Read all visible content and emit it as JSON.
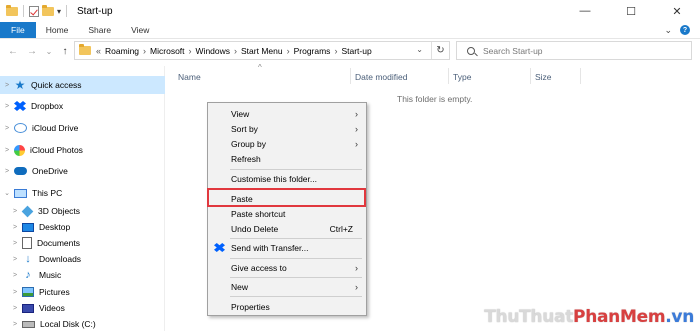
{
  "window": {
    "title": "Start-up",
    "minimize": "—",
    "maximize": "☐",
    "close": "✕"
  },
  "ribbon": {
    "tabs": [
      "File",
      "Home",
      "Share",
      "View"
    ],
    "expand_glyph": "⌄",
    "help_glyph": "?"
  },
  "nav": {
    "back": "←",
    "forward": "→",
    "recent": "⌄",
    "up": "↑",
    "breadcrumb_lead": "«",
    "breadcrumb": [
      "Roaming",
      "Microsoft",
      "Windows",
      "Start Menu",
      "Programs",
      "Start-up"
    ],
    "crumb_sep": "›",
    "refresh": "↻",
    "dropdown": "⌄",
    "search_placeholder": "Search Start-up"
  },
  "sidebar": {
    "items": [
      {
        "label": "Quick access",
        "icon": "star-icon"
      },
      {
        "label": "Dropbox",
        "icon": "dropbox-icon"
      },
      {
        "label": "iCloud Drive",
        "icon": "cloud-icon"
      },
      {
        "label": "iCloud Photos",
        "icon": "photos-icon"
      },
      {
        "label": "OneDrive",
        "icon": "onedrive-icon"
      },
      {
        "label": "This PC",
        "icon": "pc-icon"
      },
      {
        "label": "3D Objects",
        "icon": "cube-icon"
      },
      {
        "label": "Desktop",
        "icon": "desktop-icon"
      },
      {
        "label": "Documents",
        "icon": "document-icon"
      },
      {
        "label": "Downloads",
        "icon": "download-icon"
      },
      {
        "label": "Music",
        "icon": "music-icon"
      },
      {
        "label": "Pictures",
        "icon": "pictures-icon"
      },
      {
        "label": "Videos",
        "icon": "videos-icon"
      },
      {
        "label": "Local Disk (C:)",
        "icon": "disk-icon"
      }
    ]
  },
  "columns": {
    "name": "Name",
    "date_modified": "Date modified",
    "type": "Type",
    "size": "Size",
    "sort_glyph": "^"
  },
  "content": {
    "empty_message": "This folder is empty."
  },
  "context_menu": {
    "items": [
      {
        "label": "View",
        "submenu": true
      },
      {
        "label": "Sort by",
        "submenu": true
      },
      {
        "label": "Group by",
        "submenu": true
      },
      {
        "label": "Refresh"
      },
      {
        "label": "Customise this folder..."
      },
      {
        "label": "Paste",
        "highlighted": true
      },
      {
        "label": "Paste shortcut"
      },
      {
        "label": "Undo Delete",
        "shortcut": "Ctrl+Z"
      },
      {
        "label": "Send with Transfer...",
        "icon": "dropbox-icon"
      },
      {
        "label": "Give access to",
        "submenu": true
      },
      {
        "label": "New",
        "submenu": true
      },
      {
        "label": "Properties"
      }
    ],
    "submenu_glyph": "›"
  },
  "watermark": {
    "part1": "ThuThuat",
    "part2": "PhanMem",
    "part3": ".vn"
  },
  "colors": {
    "accent": "#1979ca",
    "selection": "#cce8ff",
    "highlight_border": "#e1383e"
  }
}
